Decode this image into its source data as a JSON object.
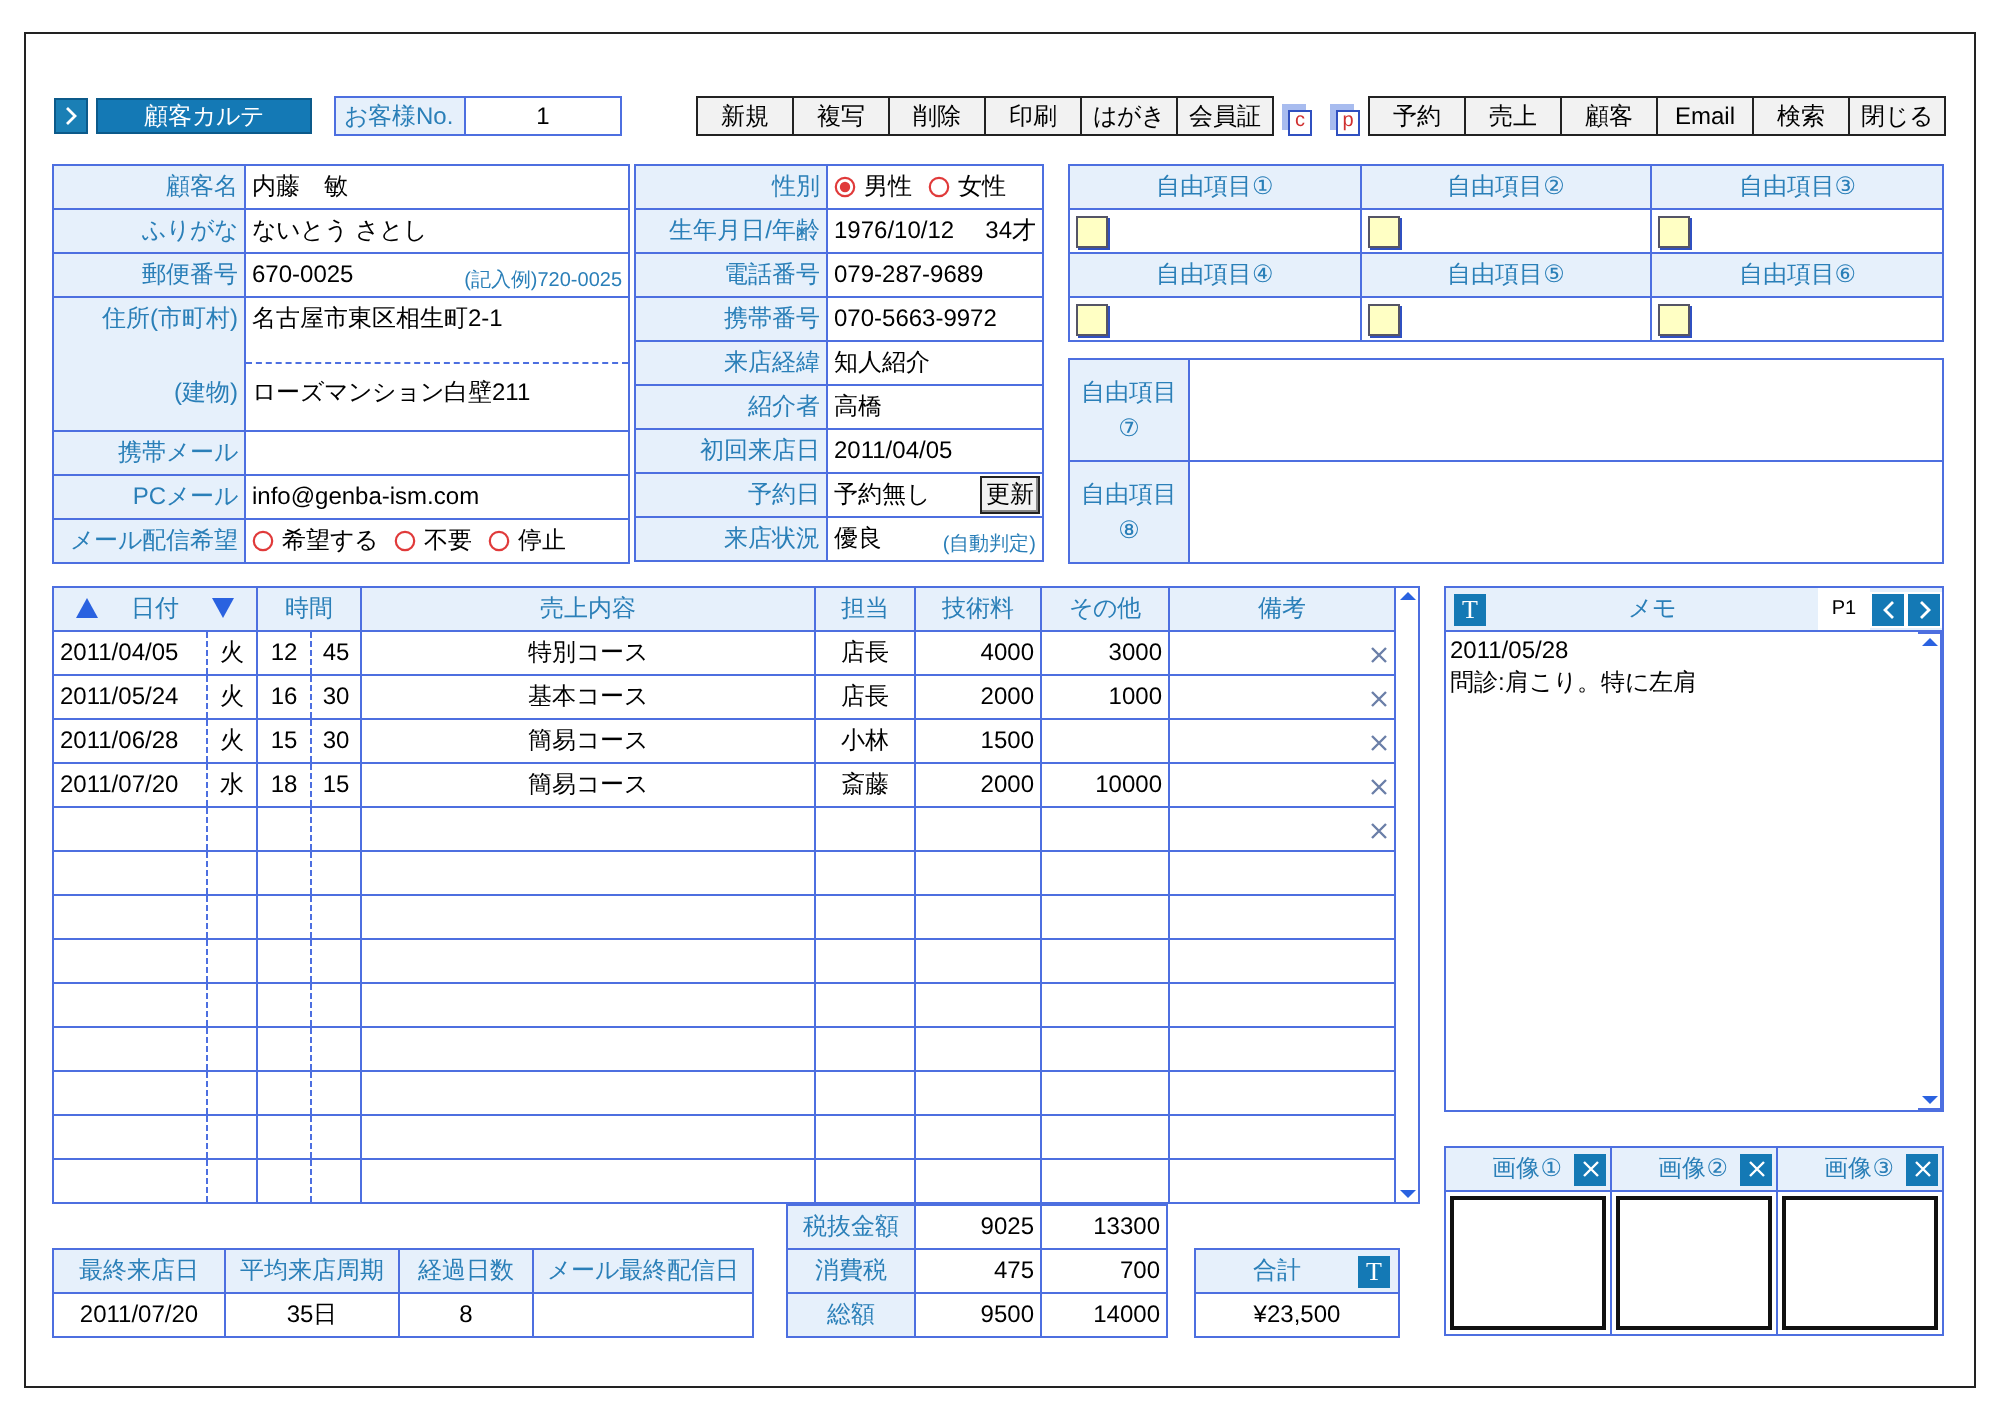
{
  "header": {
    "title": "顧客カルテ",
    "customer_no": {
      "label": "お客様No.",
      "value": "1"
    }
  },
  "toolbar": [
    {
      "kind": "text",
      "label": "新規"
    },
    {
      "kind": "text",
      "label": "複写"
    },
    {
      "kind": "text",
      "label": "削除"
    },
    {
      "kind": "text",
      "label": "印刷"
    },
    {
      "kind": "text",
      "label": "はがき"
    },
    {
      "kind": "text",
      "label": "会員証"
    },
    {
      "kind": "doc",
      "label": "c"
    },
    {
      "kind": "doc",
      "label": "p"
    },
    {
      "kind": "text",
      "label": "予約"
    },
    {
      "kind": "text",
      "label": "売上"
    },
    {
      "kind": "text",
      "label": "顧客"
    },
    {
      "kind": "text",
      "label": "Email"
    },
    {
      "kind": "text",
      "label": "検索"
    },
    {
      "kind": "text",
      "label": "閉じる"
    }
  ],
  "customer": {
    "rows": [
      {
        "kind": "text",
        "label": "顧客名",
        "value": "内藤　敏"
      },
      {
        "kind": "text",
        "label": "ふりがな",
        "value": "ないとう さとし"
      },
      {
        "kind": "text",
        "label": "郵便番号",
        "value": "670-0025",
        "hint": "(記入例)720-0025"
      },
      {
        "kind": "address",
        "label": "住所(市町村)",
        "value": "名古屋市東区相生町2-1",
        "label2": "(建物)",
        "value2": "ローズマンション白壁211"
      },
      {
        "kind": "text",
        "label": "携帯メール"
      },
      {
        "kind": "text",
        "label": "PCメール",
        "value": "info@genba-ism.com"
      },
      {
        "kind": "radio",
        "label": "メール配信希望",
        "options": [
          {
            "label": "希望する",
            "selected": false
          },
          {
            "label": "不要",
            "selected": false
          },
          {
            "label": "停止",
            "selected": false
          }
        ]
      }
    ]
  },
  "profile": {
    "rows": [
      {
        "kind": "radio",
        "label": "性別",
        "options": [
          {
            "label": "男性",
            "selected": true
          },
          {
            "label": "女性",
            "selected": false
          }
        ]
      },
      {
        "kind": "text",
        "label": "生年月日/年齢",
        "value": "1976/10/12",
        "suffix": "34才"
      },
      {
        "kind": "text",
        "label": "電話番号",
        "value": "079-287-9689"
      },
      {
        "kind": "text",
        "label": "携帯番号",
        "value": "070-5663-9972"
      },
      {
        "kind": "text",
        "label": "来店経緯",
        "value": "知人紹介"
      },
      {
        "kind": "text",
        "label": "紹介者",
        "value": "高橋"
      },
      {
        "kind": "text",
        "label": "初回来店日",
        "value": "2011/04/05"
      },
      {
        "kind": "button",
        "label": "予約日",
        "value": "予約無し",
        "button": "更新"
      },
      {
        "kind": "text",
        "label": "来店状況",
        "value": "優良",
        "hint": "(自動判定)"
      }
    ]
  },
  "free_items": {
    "small": [
      {
        "label": "自由項目①"
      },
      {
        "label": "自由項目②"
      },
      {
        "label": "自由項目③"
      },
      {
        "label": "自由項目④"
      },
      {
        "label": "自由項目⑤"
      },
      {
        "label": "自由項目⑥"
      }
    ],
    "large": [
      {
        "label": "自由項目⑦"
      },
      {
        "label": "自由項目⑧"
      }
    ]
  },
  "sales": {
    "columns": [
      "日付",
      "時間",
      "売上内容",
      "担当",
      "技術料",
      "その他",
      "備考"
    ],
    "rows": [
      {
        "date": "2011/04/05",
        "weekday": "火",
        "hour": "12",
        "minute": "45",
        "content": "特別コース",
        "staff": "店長",
        "tech_fee": "4000",
        "other": "3000",
        "delete": true
      },
      {
        "date": "2011/05/24",
        "weekday": "火",
        "hour": "16",
        "minute": "30",
        "content": "基本コース",
        "staff": "店長",
        "tech_fee": "2000",
        "other": "1000",
        "delete": true
      },
      {
        "date": "2011/06/28",
        "weekday": "火",
        "hour": "15",
        "minute": "30",
        "content": "簡易コース",
        "staff": "小林",
        "tech_fee": "1500",
        "delete": true
      },
      {
        "date": "2011/07/20",
        "weekday": "水",
        "hour": "18",
        "minute": "15",
        "content": "簡易コース",
        "staff": "斎藤",
        "tech_fee": "2000",
        "other": "10000",
        "delete": true
      },
      {
        "delete": true
      },
      {
        "delete": false
      },
      {
        "delete": false
      },
      {
        "delete": false
      },
      {
        "delete": false
      },
      {
        "delete": false
      },
      {
        "delete": false
      },
      {
        "delete": false
      },
      {
        "delete": false
      }
    ]
  },
  "totals": [
    {
      "label": "税抜金額",
      "tech_fee": "9025",
      "other": "13300"
    },
    {
      "label": "消費税",
      "tech_fee": "475",
      "other": "700"
    },
    {
      "label": "総額",
      "tech_fee": "9500",
      "other": "14000"
    }
  ],
  "summary": {
    "columns": [
      "最終来店日",
      "平均来店周期",
      "経過日数",
      "メール最終配信日"
    ],
    "values": [
      "2011/07/20",
      "35日",
      "8"
    ]
  },
  "grand_total": {
    "label": "合計",
    "button": "T",
    "value": "¥23,500"
  },
  "memo": {
    "button": "T",
    "title": "メモ",
    "page": "P1",
    "lines": [
      "2011/05/28",
      "問診:肩こり。特に左肩"
    ]
  },
  "images": [
    {
      "label": "画像①"
    },
    {
      "label": "画像②"
    },
    {
      "label": "画像③"
    }
  ]
}
